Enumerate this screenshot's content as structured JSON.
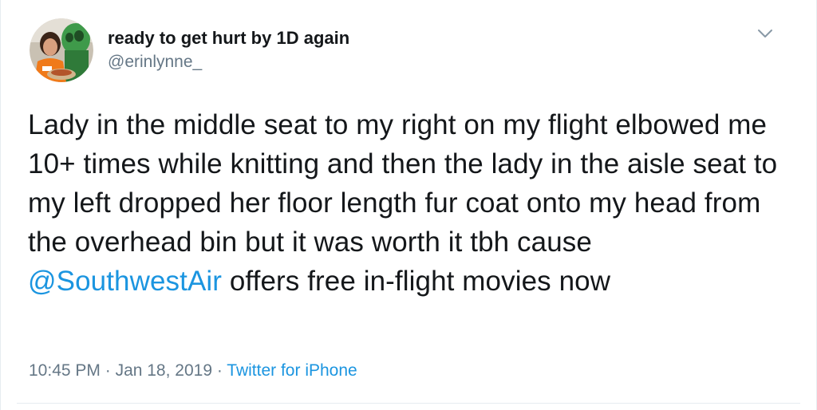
{
  "user": {
    "display_name": "ready to get hurt by 1D again",
    "handle": "@erinlynne_"
  },
  "icons": {
    "avatar": "profile-photo",
    "menu": "chevron-down-icon"
  },
  "tweet": {
    "text_before_mention": "Lady in the middle seat to my right on my flight elbowed me 10+ times while knitting and then the lady in the aisle seat to my left dropped her floor length fur coat onto my head from the overhead bin but it was worth it tbh cause ",
    "mention": "@SouthwestAir",
    "text_after_mention": " offers free in-flight movies now"
  },
  "meta": {
    "time": "10:45 PM",
    "separator_1": " · ",
    "date": "Jan 18, 2019",
    "separator_2": " · ",
    "source": "Twitter for iPhone"
  },
  "colors": {
    "text": "#14171a",
    "secondary": "#657786",
    "link": "#1b95e0",
    "border": "#e6ecf0"
  }
}
